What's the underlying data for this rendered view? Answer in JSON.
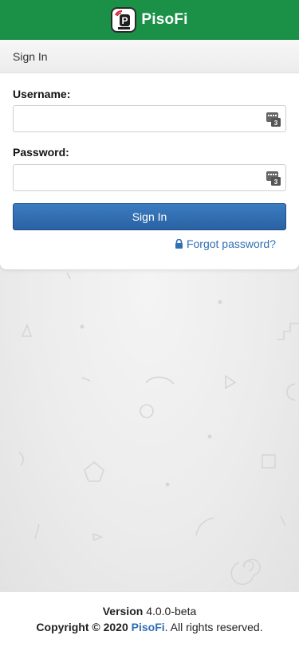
{
  "navbar": {
    "brand_name": "PisoFi",
    "logo_icon": "pisofi-logo-icon",
    "color": "#1a9146"
  },
  "login": {
    "header": "Sign In",
    "username_label": "Username:",
    "username_value": "",
    "password_label": "Password:",
    "password_value": "",
    "keyboard_icon": "virtual-keyboard-icon",
    "signin_label": "Sign In",
    "forgot_label": "Forgot password?",
    "lock_icon": "lock-icon",
    "button_color": "#2f6fb5"
  },
  "footer": {
    "version_label": "Version",
    "version_value": "4.0.0-beta",
    "copyright_prefix": "Copyright © 2020",
    "brand": "PisoFi",
    "copyright_suffix": ". All rights reserved."
  }
}
